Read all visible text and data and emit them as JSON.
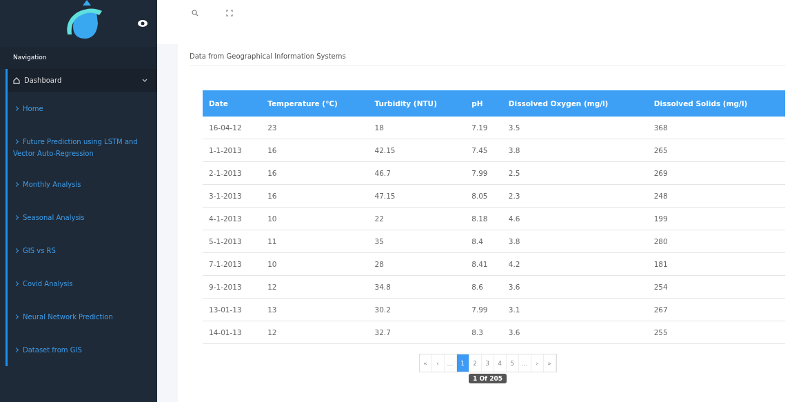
{
  "sidebar": {
    "heading": "Navigation",
    "items": [
      {
        "label": "Dashboard",
        "kind": "group",
        "expanded": true,
        "selected": true
      },
      {
        "label": "Home",
        "kind": "link",
        "selected": false
      },
      {
        "label": "Future Prediction using LSTM and Vector Auto-Regression",
        "kind": "link",
        "selected": false
      },
      {
        "label": "Monthly Analysis",
        "kind": "link",
        "selected": false
      },
      {
        "label": "Seasonal Analysis",
        "kind": "link",
        "selected": false
      },
      {
        "label": "GIS vs RS",
        "kind": "link",
        "selected": false
      },
      {
        "label": "Covid Analysis",
        "kind": "link",
        "selected": false
      },
      {
        "label": "Neural Network Prediction",
        "kind": "link",
        "selected": false
      },
      {
        "label": "Dataset from GIS",
        "kind": "link",
        "selected": false
      }
    ]
  },
  "card": {
    "title": "Data from Geographical Information Systems"
  },
  "table": {
    "columns": [
      "Date",
      "Temperature (°C)",
      "Turbidity (NTU)",
      "pH",
      "Dissolved Oxygen (mg/l)",
      "Dissolved Solids (mg/l)"
    ],
    "rows": [
      [
        "16-04-12",
        "23",
        "18",
        "7.19",
        "3.5",
        "368"
      ],
      [
        "1-1-2013",
        "16",
        "42.15",
        "7.45",
        "3.8",
        "265"
      ],
      [
        "2-1-2013",
        "16",
        "46.7",
        "7.99",
        "2.5",
        "269"
      ],
      [
        "3-1-2013",
        "16",
        "47.15",
        "8.05",
        "2.3",
        "248"
      ],
      [
        "4-1-2013",
        "10",
        "22",
        "8.18",
        "4.6",
        "199"
      ],
      [
        "5-1-2013",
        "11",
        "35",
        "8.4",
        "3.8",
        "280"
      ],
      [
        "7-1-2013",
        "10",
        "28",
        "8.41",
        "4.2",
        "181"
      ],
      [
        "9-1-2013",
        "12",
        "34.8",
        "8.6",
        "3.6",
        "254"
      ],
      [
        "13-01-13",
        "13",
        "30.2",
        "7.99",
        "3.1",
        "267"
      ],
      [
        "14-01-13",
        "12",
        "32.7",
        "8.3",
        "3.6",
        "255"
      ]
    ]
  },
  "pagination": {
    "pages": [
      {
        "label": "«",
        "selected": false
      },
      {
        "label": "‹",
        "selected": false
      },
      {
        "label": "…",
        "selected": false
      },
      {
        "label": "1",
        "selected": true
      },
      {
        "label": "2",
        "selected": false
      },
      {
        "label": "3",
        "selected": false
      },
      {
        "label": "4",
        "selected": false
      },
      {
        "label": "5",
        "selected": false
      },
      {
        "label": "…",
        "selected": false
      },
      {
        "label": "›",
        "selected": false
      },
      {
        "label": "»",
        "selected": false
      }
    ],
    "tooltip": "1 Of 205"
  }
}
